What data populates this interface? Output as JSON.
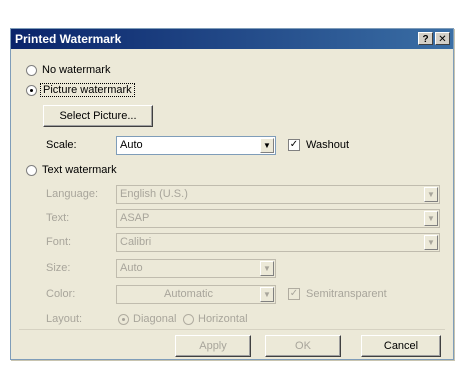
{
  "dialog": {
    "title": "Printed Watermark",
    "help_button": "?",
    "close_button": "✕"
  },
  "no_watermark": {
    "label": "No watermark",
    "selected": false
  },
  "picture_watermark": {
    "label": "Picture watermark",
    "selected": true,
    "select_picture_label": "Select Picture...",
    "scale_label": "Scale:",
    "scale_value": "Auto",
    "washout_label": "Washout",
    "washout_checked": true
  },
  "text_watermark": {
    "label": "Text watermark",
    "selected": false,
    "language_label": "Language:",
    "language_value": "English (U.S.)",
    "text_label": "Text:",
    "text_value": "ASAP",
    "font_label": "Font:",
    "font_value": "Calibri",
    "size_label": "Size:",
    "size_value": "Auto",
    "color_label": "Color:",
    "color_value": "Automatic",
    "semitransparent_label": "Semitransparent",
    "semitransparent_checked": true,
    "layout_label": "Layout:",
    "diagonal_label": "Diagonal",
    "horizontal_label": "Horizontal"
  },
  "buttons": {
    "apply": "Apply",
    "ok": "OK",
    "cancel": "Cancel"
  },
  "icons": {
    "dropdown_arrow": "chevron-down-icon",
    "check": "check-icon"
  }
}
